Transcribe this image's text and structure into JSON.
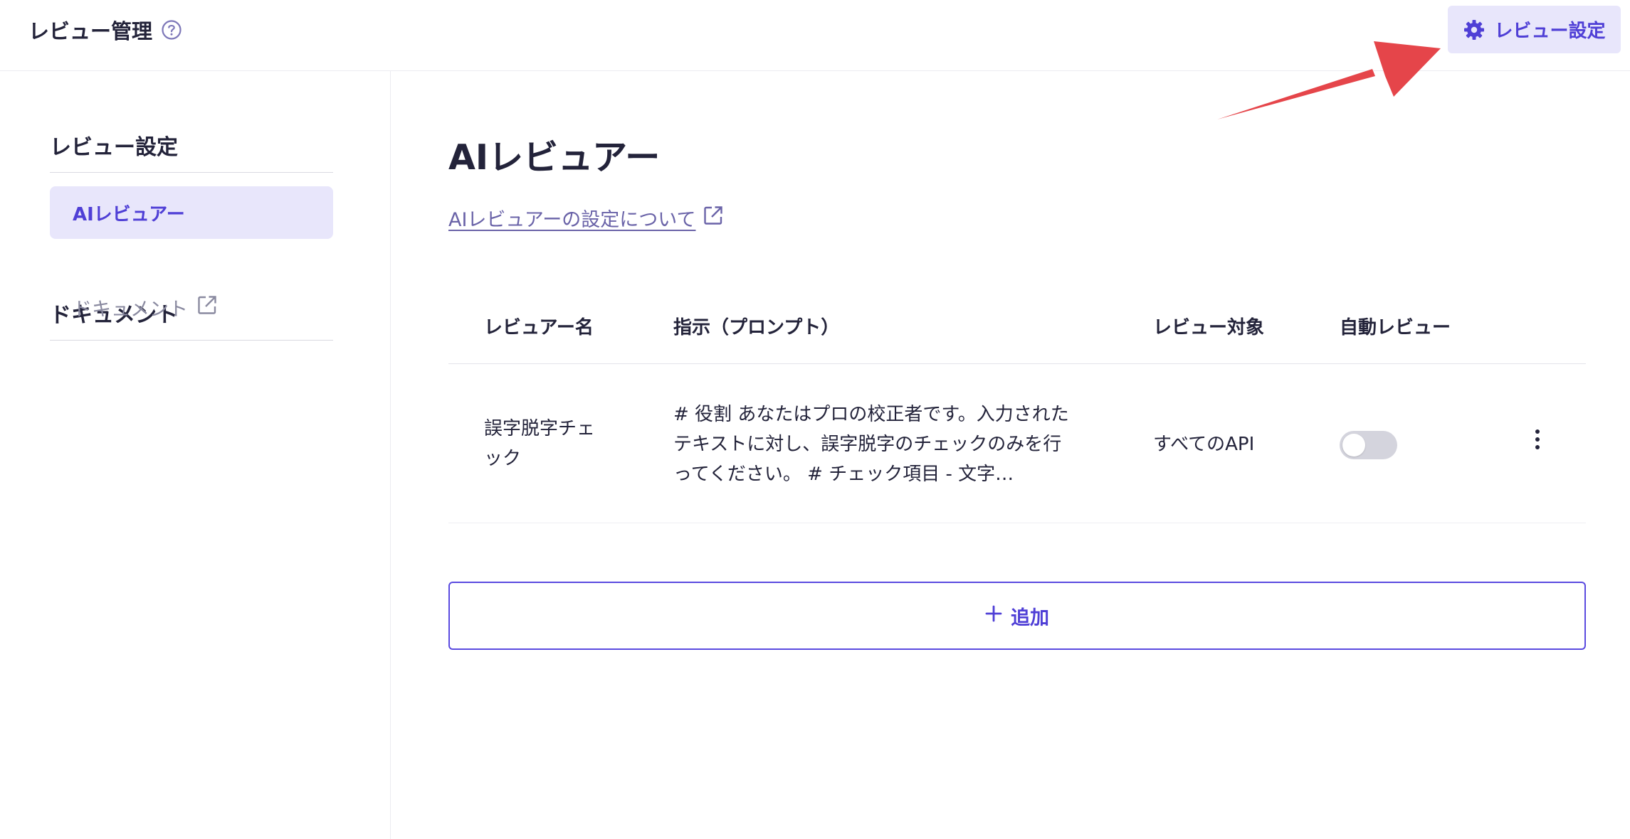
{
  "header": {
    "title": "レビュー管理",
    "help_icon": "question-circle-icon",
    "settings_button": {
      "label": "レビュー設定",
      "icon": "gear-icon"
    }
  },
  "annotation": {
    "arrow_color": "#e5454a"
  },
  "sidebar": {
    "sections": [
      {
        "heading": "レビュー設定",
        "items": [
          {
            "label": "AIレビュアー",
            "active": true
          }
        ]
      },
      {
        "heading": "ドキュメント",
        "items": [
          {
            "label": "ドキュメント",
            "icon": "external-link-icon"
          }
        ]
      }
    ]
  },
  "main": {
    "title": "AIレビュアー",
    "doc_link": {
      "label": "AIレビュアーの設定について",
      "icon": "external-link-icon"
    },
    "table": {
      "columns": [
        "レビュアー名",
        "指示（プロンプト）",
        "レビュー対象",
        "自動レビュー"
      ],
      "rows": [
        {
          "name_line1": "誤字脱字チェ",
          "name_line2": "ック",
          "prompt": "# 役割 あなたはプロの校正者です。入力されたテキストに対し、誤字脱字のチェックのみを行ってください。 # チェック項目 - 文字…",
          "target": "すべてのAPI",
          "auto_review": false,
          "menu_icon": "more-vertical-icon"
        }
      ]
    },
    "add_button": {
      "label": "追加",
      "icon": "plus-icon"
    }
  },
  "colors": {
    "accent": "#4f3fd6",
    "accent_bg": "#e8e6fb",
    "text": "#23233a",
    "muted": "#8a8aa0",
    "link": "#6a63a8"
  }
}
